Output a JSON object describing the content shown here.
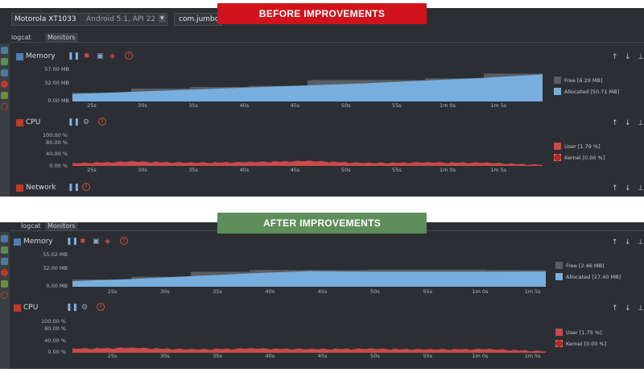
{
  "colors": {
    "panel_bg": "#2b2f33",
    "allocated": "#78aede",
    "free": "#5a5e63",
    "cpu_user": "#c94a4a",
    "banner_before": "#d0121b",
    "banner_after": "#5e8e5b"
  },
  "before": {
    "banner": "BEFORE IMPROVEMENTS",
    "device": "Motorola XT1033",
    "device_detail": "Android 5.1, API 22",
    "app": "com.jumbo",
    "tabs": [
      "logcat",
      "Monitors"
    ],
    "memory": {
      "title": "Memory",
      "y_ticks": [
        "57.00 MB",
        "32.00 MB",
        "0.00 MB"
      ],
      "x_ticks": [
        "25s",
        "30s",
        "35s",
        "40s",
        "45s",
        "50s",
        "55s",
        "1m 0s",
        "1m 5s"
      ],
      "legend": [
        "Free [6.29 MB]",
        "Allocated [50.71 MB]"
      ]
    },
    "cpu": {
      "title": "CPU",
      "y_ticks": [
        "100.00 %",
        "80.00 %",
        "40.00 %",
        "0.00 %"
      ],
      "x_ticks": [
        "25s",
        "30s",
        "35s",
        "40s",
        "45s",
        "50s",
        "55s",
        "1m 0s",
        "1m 5s"
      ],
      "legend": [
        "User [1.79 %]",
        "Kernel [0.00 %]"
      ]
    },
    "network": {
      "title": "Network"
    }
  },
  "after": {
    "banner": "AFTER IMPROVEMENTS",
    "tabs": [
      "logcat",
      "Monitors"
    ],
    "memory": {
      "title": "Memory",
      "y_ticks": [
        "55.02 MB",
        "32.00 MB",
        "0.00 MB"
      ],
      "x_ticks": [
        "25s",
        "30s",
        "35s",
        "40s",
        "45s",
        "50s",
        "55s",
        "1m 0s",
        "1m 5s"
      ],
      "legend": [
        "Free [2.46 MB]",
        "Allocated [27.40 MB]"
      ]
    },
    "cpu": {
      "title": "CPU",
      "y_ticks": [
        "100.00 %",
        "80.00 %",
        "40.00 %",
        "0.00 %"
      ],
      "x_ticks": [
        "25s",
        "30s",
        "35s",
        "40s",
        "45s",
        "50s",
        "55s",
        "1m 0s",
        "1m 5s"
      ],
      "legend": [
        "User [1.75 %]",
        "Kernel [0.00 %]"
      ]
    }
  },
  "chart_data": [
    {
      "type": "area",
      "title": "Memory",
      "panel": "before",
      "x": [
        "25s",
        "30s",
        "35s",
        "40s",
        "45s",
        "50s",
        "55s",
        "1m 0s",
        "1m 5s"
      ],
      "ylim": [
        0,
        57
      ],
      "series": [
        {
          "name": "Allocated [50.71 MB]",
          "values": [
            14,
            18,
            22,
            26,
            30,
            34,
            39,
            44,
            50.71
          ]
        },
        {
          "name": "Free [6.29 MB]",
          "values": [
            2,
            6,
            5,
            3,
            10,
            6,
            4,
            8,
            6.29
          ]
        }
      ]
    },
    {
      "type": "area",
      "title": "CPU",
      "panel": "before",
      "x": [
        "25s",
        "30s",
        "35s",
        "40s",
        "45s",
        "50s",
        "55s",
        "1m 0s",
        "1m 5s"
      ],
      "ylim": [
        0,
        100
      ],
      "series": [
        {
          "name": "User [1.79 %]",
          "values": [
            8,
            14,
            10,
            12,
            16,
            9,
            11,
            10,
            3
          ]
        },
        {
          "name": "Kernel [0.00 %]",
          "values": [
            0,
            0,
            0,
            0,
            0,
            0,
            0,
            0,
            0
          ]
        }
      ]
    },
    {
      "type": "area",
      "title": "Memory",
      "panel": "after",
      "x": [
        "25s",
        "30s",
        "35s",
        "40s",
        "45s",
        "50s",
        "55s",
        "1m 0s",
        "1m 5s"
      ],
      "ylim": [
        0,
        55.02
      ],
      "series": [
        {
          "name": "Allocated [27.40 MB]",
          "values": [
            10,
            14,
            19,
            24,
            28,
            27,
            27,
            27,
            27.4
          ]
        },
        {
          "name": "Free [2.46 MB]",
          "values": [
            3,
            4,
            8,
            6,
            2,
            4,
            4,
            3,
            2.46
          ]
        }
      ]
    },
    {
      "type": "area",
      "title": "CPU",
      "panel": "after",
      "x": [
        "25s",
        "30s",
        "35s",
        "40s",
        "45s",
        "50s",
        "55s",
        "1m 0s",
        "1m 5s"
      ],
      "ylim": [
        0,
        100
      ],
      "series": [
        {
          "name": "User [1.75 %]",
          "values": [
            12,
            15,
            10,
            13,
            11,
            12,
            10,
            11,
            4
          ]
        },
        {
          "name": "Kernel [0.00 %]",
          "values": [
            0,
            0,
            0,
            0,
            0,
            0,
            0,
            0,
            0
          ]
        }
      ]
    }
  ]
}
